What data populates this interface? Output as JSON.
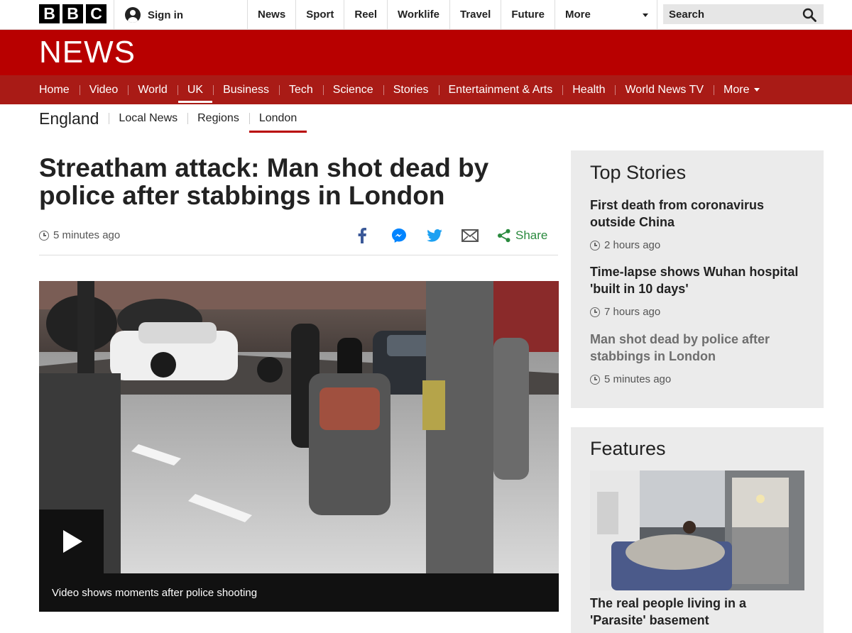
{
  "masthead": {
    "logo_letters": [
      "B",
      "B",
      "C"
    ],
    "sign_in": "Sign in",
    "nav": [
      "News",
      "Sport",
      "Reel",
      "Worklife",
      "Travel",
      "Future"
    ],
    "more": "More",
    "search_placeholder": "Search"
  },
  "news_banner": {
    "title": "NEWS",
    "nav": [
      "Home",
      "Video",
      "World",
      "UK",
      "Business",
      "Tech",
      "Science",
      "Stories",
      "Entertainment & Arts",
      "Health",
      "World News TV"
    ],
    "active": "UK",
    "more": "More"
  },
  "secondary_nav": {
    "region": "England",
    "items": [
      "Local News",
      "Regions",
      "London"
    ],
    "active": "London"
  },
  "article": {
    "headline": "Streatham attack: Man shot dead by police after stabbings in London",
    "timestamp": "5 minutes ago",
    "share_label": "Share",
    "video_caption": "Video shows moments after police shooting"
  },
  "top_stories": {
    "heading": "Top Stories",
    "items": [
      {
        "title": "First death from coronavirus outside China",
        "time": "2 hours ago"
      },
      {
        "title": "Time-lapse shows Wuhan hospital 'built in 10 days'",
        "time": "7 hours ago"
      },
      {
        "title": "Man shot dead by police after stabbings in London",
        "time": "5 minutes ago"
      }
    ]
  },
  "features": {
    "heading": "Features",
    "items": [
      {
        "title": "The real people living in a 'Parasite' basement"
      }
    ]
  },
  "colors": {
    "brand_red": "#b80000",
    "nav_red": "#a91b16",
    "share_green": "#2a8a3e",
    "facebook_blue": "#3b5998",
    "messenger_blue": "#0084ff",
    "twitter_blue": "#1da1f2"
  },
  "icons": [
    "user-icon",
    "search-icon",
    "clock-icon",
    "facebook-icon",
    "messenger-icon",
    "twitter-icon",
    "email-icon",
    "share-icon",
    "play-icon"
  ]
}
